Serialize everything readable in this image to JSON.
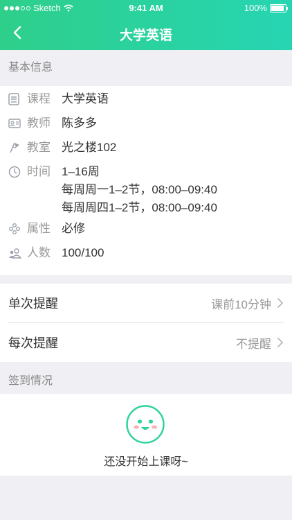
{
  "status_bar": {
    "carrier": "Sketch",
    "time": "9:41 AM",
    "battery": "100%"
  },
  "nav": {
    "title": "大学英语"
  },
  "basic_info": {
    "title": "基本信息",
    "rows": [
      {
        "icon": "book-icon",
        "label": "课程",
        "value": "大学英语"
      },
      {
        "icon": "id-card-icon",
        "label": "教师",
        "value": "陈多多"
      },
      {
        "icon": "flag-icon",
        "label": "教室",
        "value": "光之楼102"
      },
      {
        "icon": "clock-icon",
        "label": "时间",
        "values": [
          "1–16周",
          "每周周一1–2节，08:00–09:40",
          "每周周四1–2节，08:00–09:40"
        ]
      },
      {
        "icon": "attribute-icon",
        "label": "属性",
        "value": "必修"
      },
      {
        "icon": "people-icon",
        "label": "人数",
        "value": "100/100"
      }
    ]
  },
  "reminders": [
    {
      "label": "单次提醒",
      "value": "课前10分钟"
    },
    {
      "label": "每次提醒",
      "value": "不提醒"
    }
  ],
  "signin": {
    "title": "签到情况",
    "empty_text": "还没开始上课呀~"
  },
  "colors": {
    "primary": "#2ecf8a",
    "secondary": "#27d5b3"
  }
}
